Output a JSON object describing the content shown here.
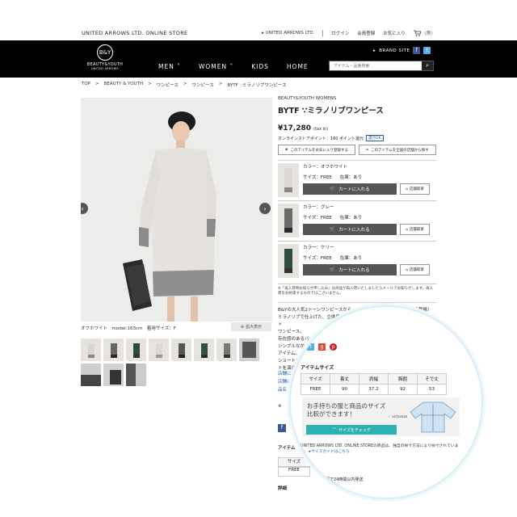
{
  "store": {
    "name": "UNITED ARROWS LTD. ONLINE STORE",
    "links": [
      "UNITED ARROWS LTD.",
      "ログイン",
      "会員登録",
      "お気に入り"
    ],
    "cart_count": "0"
  },
  "header": {
    "logo_text": "BEAUTY&YOUTH",
    "logo_sub": "UNITED ARROWS",
    "nav": [
      "MEN",
      "WOMEN",
      "KIDS",
      "HOME"
    ],
    "brand_site": "BRAND SITE",
    "search_placeholder": "アイテム・品番検索"
  },
  "breadcrumb": [
    "TOP",
    ">",
    "BEAUTY & YOUTH",
    ">",
    "ワンピース",
    ">",
    "ワンピース",
    ">",
    "BYTF ∵ミラノリブワンピース"
  ],
  "photo": {
    "caption": "オフホワイト　model:163cm　着用サイズ：F",
    "zoom_label": "拡大表示"
  },
  "product": {
    "brand": "BEAUTY&YOUTH WOMENS",
    "name": "BYTF ∵ミラノリブワンピース",
    "price": "¥17,280",
    "tax": "(tax in)",
    "points": "オンラインストアポイント：160 ポイント還元",
    "points_badge": "還元OK",
    "fav_btn": "このアイテムをお気に入り登録する",
    "stock_btn": "このアイテムを全国の店舗から探す"
  },
  "variants": [
    {
      "color": "カラー：オフホワイト",
      "size": "サイズ：FREE",
      "stock": "在庫：あり",
      "cart": "カートに入れる",
      "store": "店舗取寄"
    },
    {
      "color": "カラー：グレー",
      "size": "サイズ：FREE",
      "stock": "在庫：あり",
      "cart": "カートに入れる",
      "store": "店舗取寄"
    },
    {
      "color": "カラー：ケリー",
      "size": "サイズ：FREE",
      "stock": "在庫：あり",
      "cart": "カートに入れる",
      "store": "店舗取寄"
    }
  ],
  "note": "※「再入荷時お知らせ申し込み」は商品が再入荷いたしましたらメールでお知らせします。再入荷をお約束するものではございません。",
  "description": [
    "B&Yの大人気2トーンワンピースから、今年らしいトレンドカラーが新登場！",
    "ミラノリブで仕上げた、立体感のあるフォルムと品のある風合いが魅力のニット",
    "ワンピース。",
    "存在感のあるバイカラー切り替えデザ、実際の商品と色は、仕様により",
    "シンプルながら、一枚でも様になります。",
    "アイテム。",
    "ショートブーツ",
    "トを演出します"
  ],
  "lower_left": [
    "店舗に",
    "店舗により",
    "品名",
    "※",
    "アイテム",
    "サイズ",
    "FREE",
    "詳細"
  ],
  "size_section": {
    "title": "アイテムサイズ",
    "headers": [
      "サイズ",
      "着丈",
      "肩幅",
      "胸囲",
      "そで丈"
    ],
    "row": [
      "FREE",
      "90",
      "37.2",
      "92",
      "53"
    ]
  },
  "fit": {
    "line1": "お手持ちの服と商品のサイズ",
    "line2": "比較ができます！",
    "logo": "virtusize",
    "button": "サイズをチェック",
    "note": "UNITED ARROWS LTD. ONLINE STOREの商品は、独自の採寸方法により採寸されています。",
    "link": "サイズガイドはこちら"
  },
  "delivery": {
    "title": "詳細",
    "text": "最短で24時間以内発送"
  },
  "colors": {
    "black": "#000000",
    "cart_btn": "#555555",
    "fit_btn": "#2bb3b3",
    "facebook": "#3b5998",
    "twitter": "#55acee",
    "google": "#dd4b39",
    "pinterest": "#cb2027"
  }
}
